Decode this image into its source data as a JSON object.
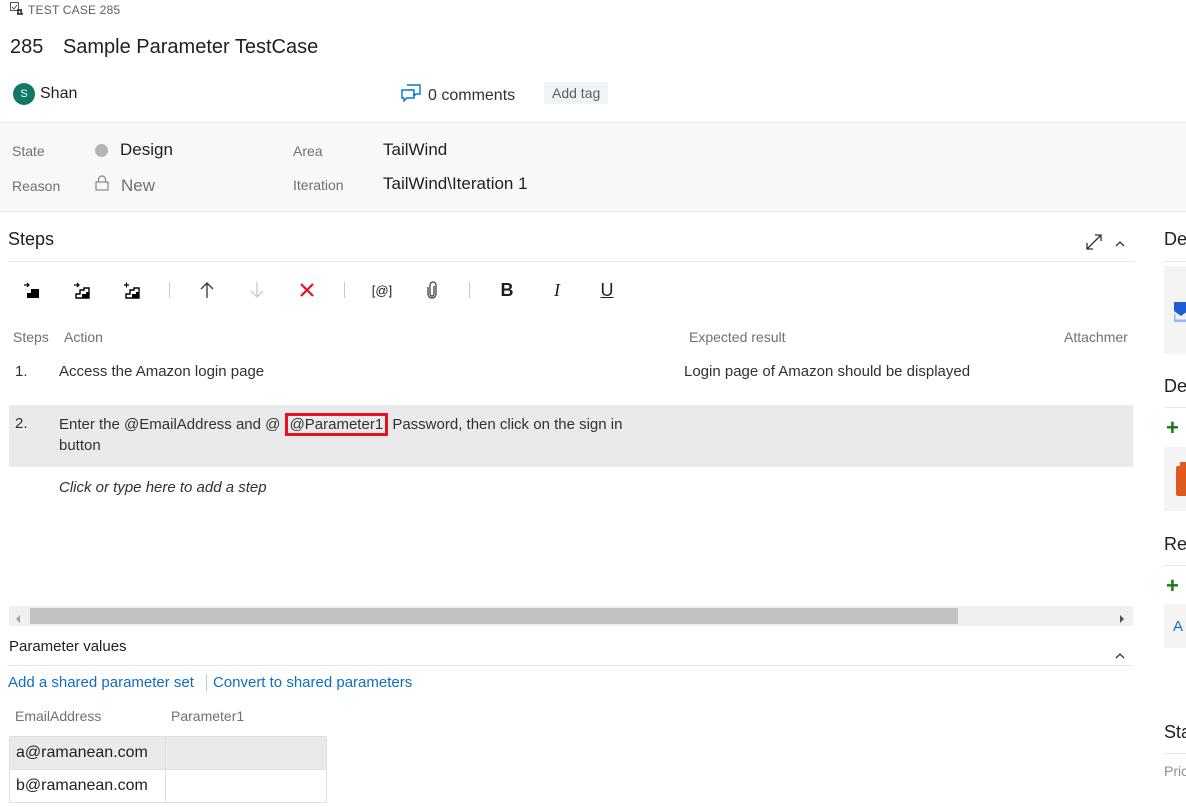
{
  "header": {
    "work_item_type": "TEST CASE 285",
    "id": "285",
    "title": "Sample Parameter TestCase",
    "owner": {
      "initial": "S",
      "name": "Shan",
      "avatar_color": "#117865"
    },
    "comments_label": "0 comments",
    "add_tag_label": "Add tag"
  },
  "fields": {
    "state_label": "State",
    "state_value": "Design",
    "reason_label": "Reason",
    "reason_value": "New",
    "area_label": "Area",
    "area_value": "TailWind",
    "iteration_label": "Iteration",
    "iteration_value": "TailWind\\Iteration 1"
  },
  "steps": {
    "title": "Steps",
    "toolbar": {
      "insert_step": "insert-step",
      "insert_shared_steps": "insert-shared-steps",
      "create_shared_steps": "create-shared-steps",
      "move_up": "↑",
      "move_down": "↓",
      "delete": "✕",
      "insert_parameter": "[@]",
      "attach": "attachment",
      "bold": "B",
      "italic": "I",
      "underline": "U"
    },
    "columns": {
      "steps": "Steps",
      "action": "Action",
      "expected": "Expected result",
      "attachments": "Attachmer"
    },
    "rows": [
      {
        "num": "1.",
        "action": "Access the Amazon login page",
        "expected": "Login page of Amazon should be displayed"
      },
      {
        "num": "2.",
        "action_before": "Enter the @EmailAddress and @ ",
        "action_highlight": "@Parameter1",
        "action_after": " Password, then click on the sign in button",
        "expected": ""
      }
    ],
    "add_step_placeholder": "Click or type here to add a step"
  },
  "parameters": {
    "title": "Parameter values",
    "add_shared_link": "Add a shared parameter set",
    "convert_link": "Convert to shared parameters",
    "columns": [
      "EmailAddress",
      "Parameter1"
    ],
    "rows": [
      [
        "a@ramanean.com",
        ""
      ],
      [
        "b@ramanean.com",
        ""
      ]
    ]
  },
  "right_panel": {
    "sections": [
      "De",
      "De",
      "Re",
      "Sta"
    ],
    "link_letter": "A",
    "priority_label": "Pric"
  },
  "colors": {
    "highlight": "#e81123",
    "link": "#106ebe",
    "add": "#107c10"
  }
}
